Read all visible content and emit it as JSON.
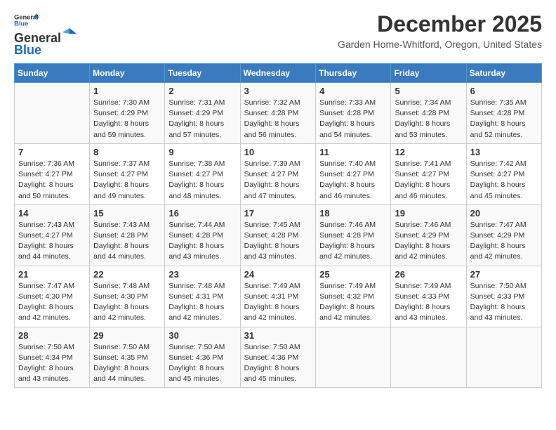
{
  "header": {
    "logo_line1": "General",
    "logo_line2": "Blue",
    "month_title": "December 2025",
    "location": "Garden Home-Whitford, Oregon, United States"
  },
  "columns": [
    "Sunday",
    "Monday",
    "Tuesday",
    "Wednesday",
    "Thursday",
    "Friday",
    "Saturday"
  ],
  "weeks": [
    [
      {
        "day": "",
        "info": ""
      },
      {
        "day": "1",
        "info": "Sunrise: 7:30 AM\nSunset: 4:29 PM\nDaylight: 8 hours\nand 59 minutes."
      },
      {
        "day": "2",
        "info": "Sunrise: 7:31 AM\nSunset: 4:29 PM\nDaylight: 8 hours\nand 57 minutes."
      },
      {
        "day": "3",
        "info": "Sunrise: 7:32 AM\nSunset: 4:28 PM\nDaylight: 8 hours\nand 56 minutes."
      },
      {
        "day": "4",
        "info": "Sunrise: 7:33 AM\nSunset: 4:28 PM\nDaylight: 8 hours\nand 54 minutes."
      },
      {
        "day": "5",
        "info": "Sunrise: 7:34 AM\nSunset: 4:28 PM\nDaylight: 8 hours\nand 53 minutes."
      },
      {
        "day": "6",
        "info": "Sunrise: 7:35 AM\nSunset: 4:28 PM\nDaylight: 8 hours\nand 52 minutes."
      }
    ],
    [
      {
        "day": "7",
        "info": "Sunrise: 7:36 AM\nSunset: 4:27 PM\nDaylight: 8 hours\nand 50 minutes."
      },
      {
        "day": "8",
        "info": "Sunrise: 7:37 AM\nSunset: 4:27 PM\nDaylight: 8 hours\nand 49 minutes."
      },
      {
        "day": "9",
        "info": "Sunrise: 7:38 AM\nSunset: 4:27 PM\nDaylight: 8 hours\nand 48 minutes."
      },
      {
        "day": "10",
        "info": "Sunrise: 7:39 AM\nSunset: 4:27 PM\nDaylight: 8 hours\nand 47 minutes."
      },
      {
        "day": "11",
        "info": "Sunrise: 7:40 AM\nSunset: 4:27 PM\nDaylight: 8 hours\nand 46 minutes."
      },
      {
        "day": "12",
        "info": "Sunrise: 7:41 AM\nSunset: 4:27 PM\nDaylight: 8 hours\nand 46 minutes."
      },
      {
        "day": "13",
        "info": "Sunrise: 7:42 AM\nSunset: 4:27 PM\nDaylight: 8 hours\nand 45 minutes."
      }
    ],
    [
      {
        "day": "14",
        "info": "Sunrise: 7:43 AM\nSunset: 4:27 PM\nDaylight: 8 hours\nand 44 minutes."
      },
      {
        "day": "15",
        "info": "Sunrise: 7:43 AM\nSunset: 4:28 PM\nDaylight: 8 hours\nand 44 minutes."
      },
      {
        "day": "16",
        "info": "Sunrise: 7:44 AM\nSunset: 4:28 PM\nDaylight: 8 hours\nand 43 minutes."
      },
      {
        "day": "17",
        "info": "Sunrise: 7:45 AM\nSunset: 4:28 PM\nDaylight: 8 hours\nand 43 minutes."
      },
      {
        "day": "18",
        "info": "Sunrise: 7:46 AM\nSunset: 4:28 PM\nDaylight: 8 hours\nand 42 minutes."
      },
      {
        "day": "19",
        "info": "Sunrise: 7:46 AM\nSunset: 4:29 PM\nDaylight: 8 hours\nand 42 minutes."
      },
      {
        "day": "20",
        "info": "Sunrise: 7:47 AM\nSunset: 4:29 PM\nDaylight: 8 hours\nand 42 minutes."
      }
    ],
    [
      {
        "day": "21",
        "info": "Sunrise: 7:47 AM\nSunset: 4:30 PM\nDaylight: 8 hours\nand 42 minutes."
      },
      {
        "day": "22",
        "info": "Sunrise: 7:48 AM\nSunset: 4:30 PM\nDaylight: 8 hours\nand 42 minutes."
      },
      {
        "day": "23",
        "info": "Sunrise: 7:48 AM\nSunset: 4:31 PM\nDaylight: 8 hours\nand 42 minutes."
      },
      {
        "day": "24",
        "info": "Sunrise: 7:49 AM\nSunset: 4:31 PM\nDaylight: 8 hours\nand 42 minutes."
      },
      {
        "day": "25",
        "info": "Sunrise: 7:49 AM\nSunset: 4:32 PM\nDaylight: 8 hours\nand 42 minutes."
      },
      {
        "day": "26",
        "info": "Sunrise: 7:49 AM\nSunset: 4:33 PM\nDaylight: 8 hours\nand 43 minutes."
      },
      {
        "day": "27",
        "info": "Sunrise: 7:50 AM\nSunset: 4:33 PM\nDaylight: 8 hours\nand 43 minutes."
      }
    ],
    [
      {
        "day": "28",
        "info": "Sunrise: 7:50 AM\nSunset: 4:34 PM\nDaylight: 8 hours\nand 43 minutes."
      },
      {
        "day": "29",
        "info": "Sunrise: 7:50 AM\nSunset: 4:35 PM\nDaylight: 8 hours\nand 44 minutes."
      },
      {
        "day": "30",
        "info": "Sunrise: 7:50 AM\nSunset: 4:36 PM\nDaylight: 8 hours\nand 45 minutes."
      },
      {
        "day": "31",
        "info": "Sunrise: 7:50 AM\nSunset: 4:36 PM\nDaylight: 8 hours\nand 45 minutes."
      },
      {
        "day": "",
        "info": ""
      },
      {
        "day": "",
        "info": ""
      },
      {
        "day": "",
        "info": ""
      }
    ]
  ]
}
